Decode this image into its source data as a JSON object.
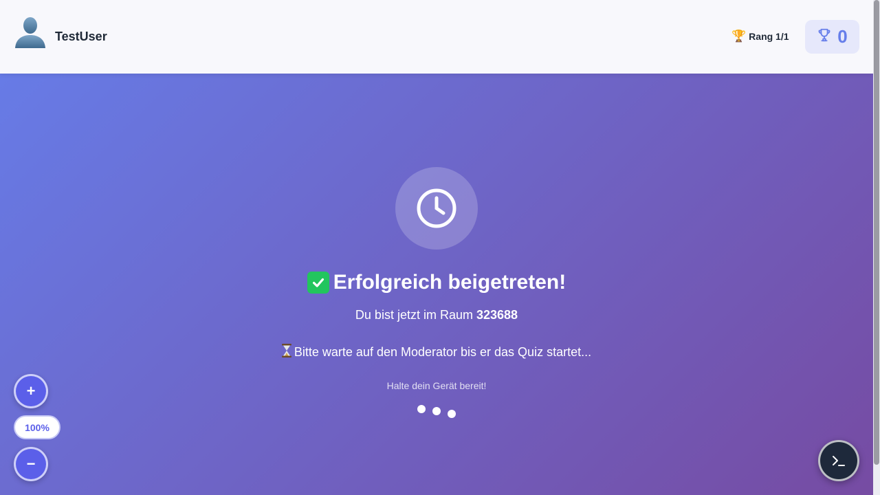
{
  "header": {
    "username": "TestUser",
    "rank_label": "Rang 1/1",
    "score": "0"
  },
  "main": {
    "title": "Erfolgreich beigetreten!",
    "room_prefix": "Du bist jetzt im Raum",
    "room_code": "323688",
    "wait_message": "Bitte warte auf den Moderator bis er das Quiz startet...",
    "hint": "Halte dein Gerät bereit!"
  },
  "zoom": {
    "plus_label": "+",
    "level": "100%",
    "minus_label": "−"
  },
  "icons": {
    "avatar": "user-silhouette-icon",
    "rank": "trophy-emoji-icon",
    "score": "trophy-outline-icon",
    "status": "clock-icon",
    "success": "check-mark-icon",
    "waiting": "hourglass-icon",
    "console": "terminal-icon"
  },
  "colors": {
    "gradient_start": "#667eea",
    "gradient_end": "#764ba2",
    "accent": "#667eea",
    "success": "#22c55e"
  }
}
